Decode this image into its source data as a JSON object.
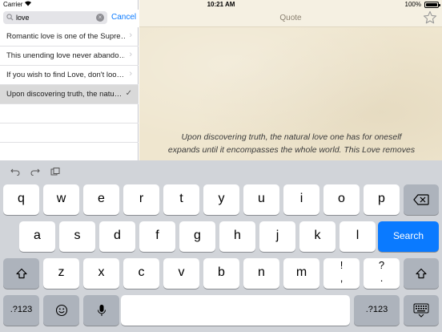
{
  "status_bar": {
    "carrier": "Carrier",
    "time": "10:21 AM",
    "battery": "100%"
  },
  "search": {
    "value": "love",
    "cancel_label": "Cancel"
  },
  "results": [
    {
      "text": "Romantic love is one of the Supre…",
      "selected": false
    },
    {
      "text": "This unending love never abando…",
      "selected": false
    },
    {
      "text": "If you wish to find Love, don't loo…",
      "selected": false
    },
    {
      "text": "Upon discovering truth, the natu…",
      "selected": true
    }
  ],
  "detail": {
    "title": "Quote",
    "quote_line1": "Upon discovering truth, the natural love one has for oneself",
    "quote_line2": "expands until it encompasses the whole world. This Love removes"
  },
  "keyboard": {
    "row1": [
      "q",
      "w",
      "e",
      "r",
      "t",
      "y",
      "u",
      "i",
      "o",
      "p"
    ],
    "row2": [
      "a",
      "s",
      "d",
      "f",
      "g",
      "h",
      "j",
      "k",
      "l"
    ],
    "row3": [
      "z",
      "x",
      "c",
      "v",
      "b",
      "n",
      "m"
    ],
    "search_label": "Search",
    "numbers_label": ".?123",
    "punct1_top": "!",
    "punct1_bot": ",",
    "punct2_top": "?",
    "punct2_bot": ".",
    "accent_color": "#0a7aff"
  }
}
